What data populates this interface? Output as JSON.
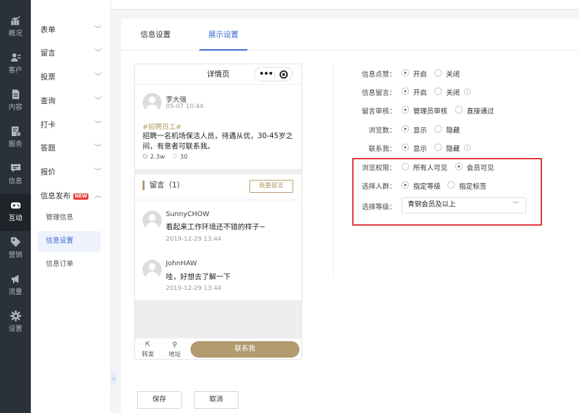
{
  "rail": [
    {
      "label": "概况",
      "icon": "chart-icon"
    },
    {
      "label": "客户",
      "icon": "users-icon"
    },
    {
      "label": "内容",
      "icon": "document-icon"
    },
    {
      "label": "服务",
      "icon": "service-icon"
    },
    {
      "label": "信息",
      "icon": "message-icon"
    },
    {
      "label": "互动",
      "icon": "gamepad-icon"
    },
    {
      "label": "营销",
      "icon": "tag-icon"
    },
    {
      "label": "流量",
      "icon": "megaphone-icon"
    },
    {
      "label": "设置",
      "icon": "gear-icon"
    }
  ],
  "sidebar": {
    "items": [
      {
        "label": "表单"
      },
      {
        "label": "留言"
      },
      {
        "label": "投票"
      },
      {
        "label": "查询"
      },
      {
        "label": "打卡"
      },
      {
        "label": "答题"
      },
      {
        "label": "报价"
      },
      {
        "label": "信息发布",
        "badge": "NEW"
      }
    ],
    "sub_items": [
      {
        "label": "管理信息"
      },
      {
        "label": "信息设置"
      },
      {
        "label": "信息订单"
      }
    ]
  },
  "tabs": [
    {
      "label": "信息设置"
    },
    {
      "label": "展示设置"
    }
  ],
  "preview": {
    "title": "详情页",
    "post": {
      "author": "李大强",
      "time": "05-07 10:44",
      "tag": "#招聘员工#",
      "body": "招聘一名机场保洁人员，待遇从优，30-45岁之间，有意者可联系我。",
      "views": "2.3w",
      "likes": "30"
    },
    "messages_title": "留言（1）",
    "leave_message_btn": "我要留言",
    "comments": [
      {
        "name": "SunnyCHOW",
        "text": "看起来工作环境还不错的样子~",
        "time": "2019-12-29 13:44"
      },
      {
        "name": "JohnHAW",
        "text": "哇，好想去了解一下",
        "time": "2019-12-29 13:44"
      }
    ],
    "footer": {
      "share": "转发",
      "address": "地址",
      "contact": "联系我"
    }
  },
  "settings": {
    "like": {
      "label": "信息点赞：",
      "options": [
        "开启",
        "关闭"
      ],
      "selected": 0
    },
    "comment": {
      "label": "信息留言：",
      "options": [
        "开启",
        "关闭"
      ],
      "selected": 0
    },
    "review": {
      "label": "留言审核：",
      "options": [
        "管理员审核",
        "直接通过"
      ],
      "selected": 0
    },
    "views": {
      "label": "浏览数：",
      "options": [
        "显示",
        "隐藏"
      ],
      "selected": 0
    },
    "contact": {
      "label": "联系我：",
      "options": [
        "显示",
        "隐藏"
      ],
      "selected": 0
    },
    "permission": {
      "label": "浏览权限：",
      "options": [
        "所有人可见",
        "会员可见"
      ],
      "selected": 1
    },
    "audience": {
      "label": "选择人群：",
      "options": [
        "指定等级",
        "指定标签"
      ],
      "selected": 0
    },
    "level": {
      "label": "选择等级：",
      "value": "青铜会员及以上"
    }
  },
  "actions": {
    "save": "保存",
    "cancel": "取消"
  },
  "colors": {
    "accent": "#3a6bd6",
    "gold": "#b09a6e",
    "highlight": "#e0323a",
    "rail": "#2a3139"
  }
}
